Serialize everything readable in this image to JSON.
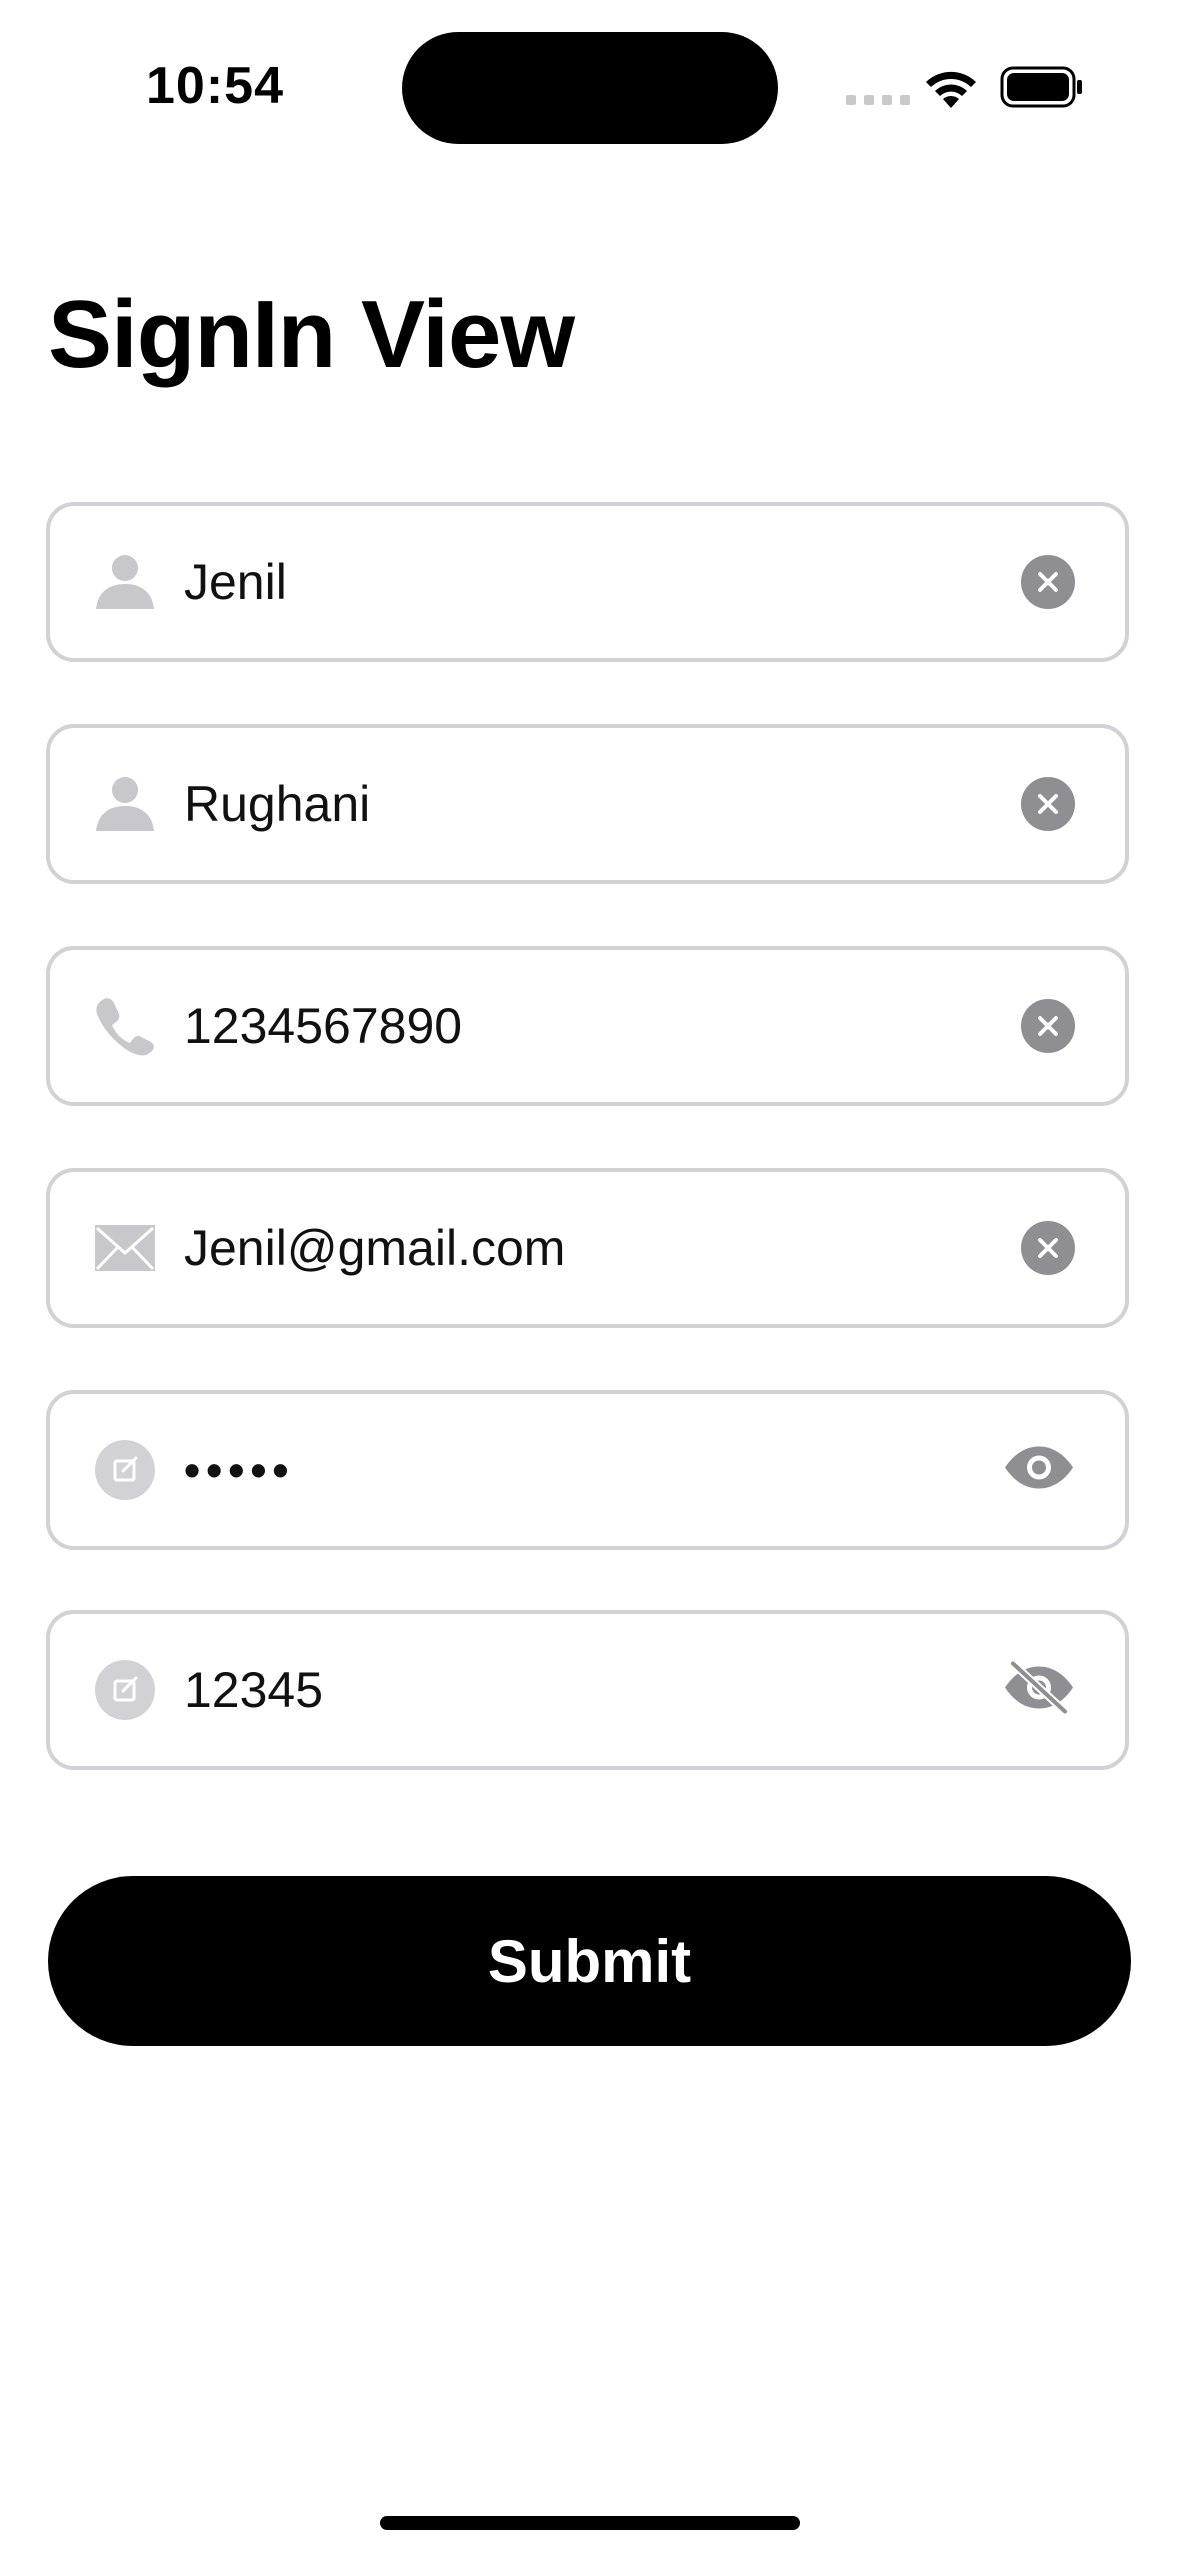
{
  "status_bar": {
    "time": "10:54"
  },
  "page": {
    "title": "SignIn View"
  },
  "fields": [
    {
      "icon": "person-icon",
      "value": "Jenil",
      "trailing": "clear-icon"
    },
    {
      "icon": "person-icon",
      "value": "Rughani",
      "trailing": "clear-icon"
    },
    {
      "icon": "phone-icon",
      "value": "1234567890",
      "trailing": "clear-icon"
    },
    {
      "icon": "envelope-icon",
      "value": "Jenil@gmail.com",
      "trailing": "clear-icon"
    },
    {
      "icon": "edit-icon",
      "value": "•••••",
      "trailing": "eye-icon"
    },
    {
      "icon": "edit-icon",
      "value": "12345",
      "trailing": "eye-slash-icon"
    }
  ],
  "submit": {
    "label": "Submit"
  },
  "colors": {
    "border": "#d1d1d6",
    "icon_gray": "#c7c7cc",
    "button_gray": "#8e8e93",
    "submit_bg": "#000000"
  }
}
